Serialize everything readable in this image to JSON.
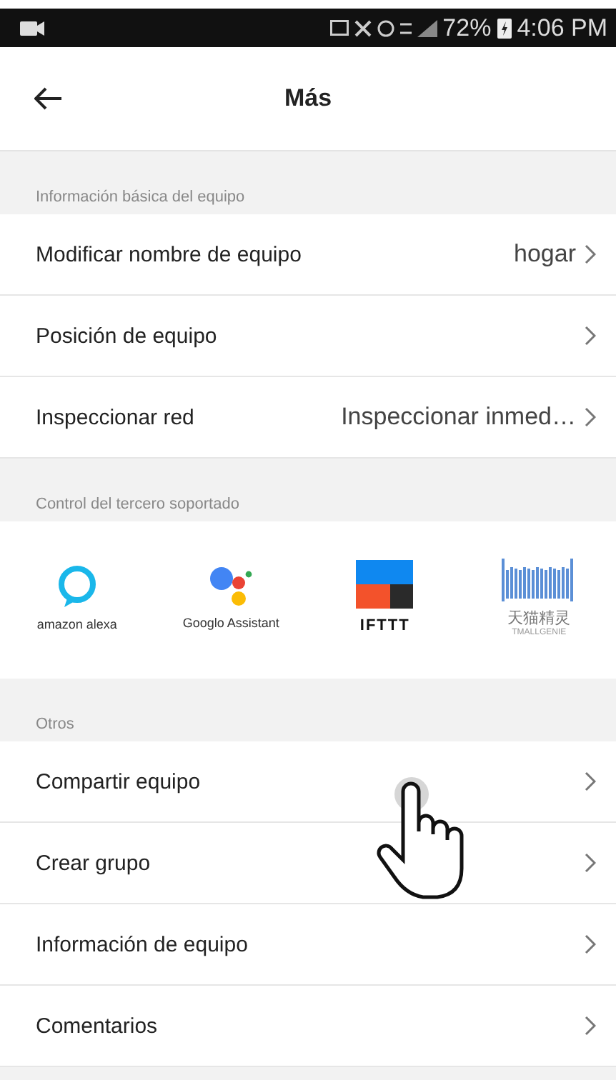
{
  "status_bar": {
    "battery": "72%",
    "time": "4:06 PM"
  },
  "header": {
    "title": "Más"
  },
  "sections": [
    {
      "kind": "list",
      "title": "Información básica del equipo",
      "items": [
        {
          "label": "Modificar nombre de equipo",
          "value": "hogar"
        },
        {
          "label": "Posición de equipo"
        },
        {
          "label": "Inspeccionar red",
          "value": "Inspeccionar inmed…"
        }
      ]
    },
    {
      "kind": "logos",
      "title": "Control del tercero soportado",
      "items": [
        {
          "kind": "alexa",
          "label": "amazon alexa"
        },
        {
          "kind": "assistant",
          "label": "Googlo Assistant"
        },
        {
          "kind": "ifttt",
          "label": "IFTTT"
        },
        {
          "kind": "tmall",
          "label": "天猫精灵",
          "sublabel": "TMALLGENIE"
        }
      ]
    },
    {
      "kind": "list",
      "title": "Otros",
      "items": [
        {
          "label": "Compartir equipo"
        },
        {
          "label": "Crear grupo"
        },
        {
          "label": "Información de equipo"
        },
        {
          "label": "Comentarios"
        }
      ]
    }
  ]
}
